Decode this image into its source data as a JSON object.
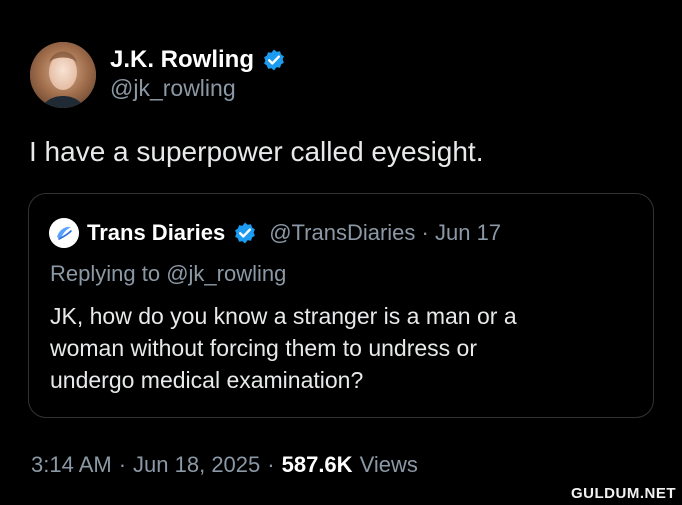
{
  "author": {
    "name": "J.K. Rowling",
    "handle": "@jk_rowling",
    "verified": true,
    "verified_color": "#1d9bf0"
  },
  "tweet": {
    "text": "I have a superpower called eyesight."
  },
  "quoted_tweet": {
    "author_name": "Trans Diaries",
    "handle": "@TransDiaries",
    "date": "Jun 17",
    "replying_to_label": "Replying to",
    "replying_to_handle": "@jk_rowling",
    "text": "JK, how do you know a stranger is a man or a\nwoman without forcing them to undress or\nundergo medical examination?"
  },
  "meta": {
    "time": "3:14 AM",
    "date": "Jun 18, 2025",
    "views_count": "587.6K",
    "views_label": "Views"
  },
  "watermark": "GULDUM.NET"
}
